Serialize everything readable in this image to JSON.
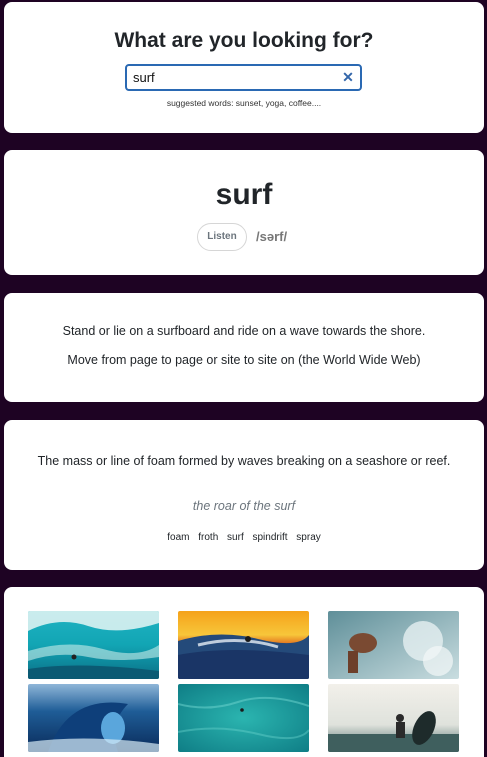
{
  "search": {
    "title": "What are you looking for?",
    "value": "surf",
    "clear_icon": "close-icon",
    "suggestions": "suggested words: sunset, yoga, coffee...."
  },
  "word": {
    "term": "surf",
    "listen_label": "Listen",
    "phonetic": "/sərf/"
  },
  "definitions": [
    "Stand or lie on a surfboard and ride on a wave towards the shore.",
    "Move from page to page or site to site on (the World Wide Web)"
  ],
  "noun_meaning": {
    "definition": "The mass or line of foam formed by waves breaking on a seashore or reef.",
    "example": "the roar of the surf",
    "synonyms": [
      "foam",
      "froth",
      "surf",
      "spindrift",
      "spray"
    ]
  },
  "images": [
    {
      "icon": "wave-photo"
    },
    {
      "icon": "sunset-surfer-photo"
    },
    {
      "icon": "surfer-splash-photo"
    },
    {
      "icon": "barrel-wave-photo"
    },
    {
      "icon": "aerial-ocean-photo"
    },
    {
      "icon": "surfer-board-photo"
    }
  ]
}
